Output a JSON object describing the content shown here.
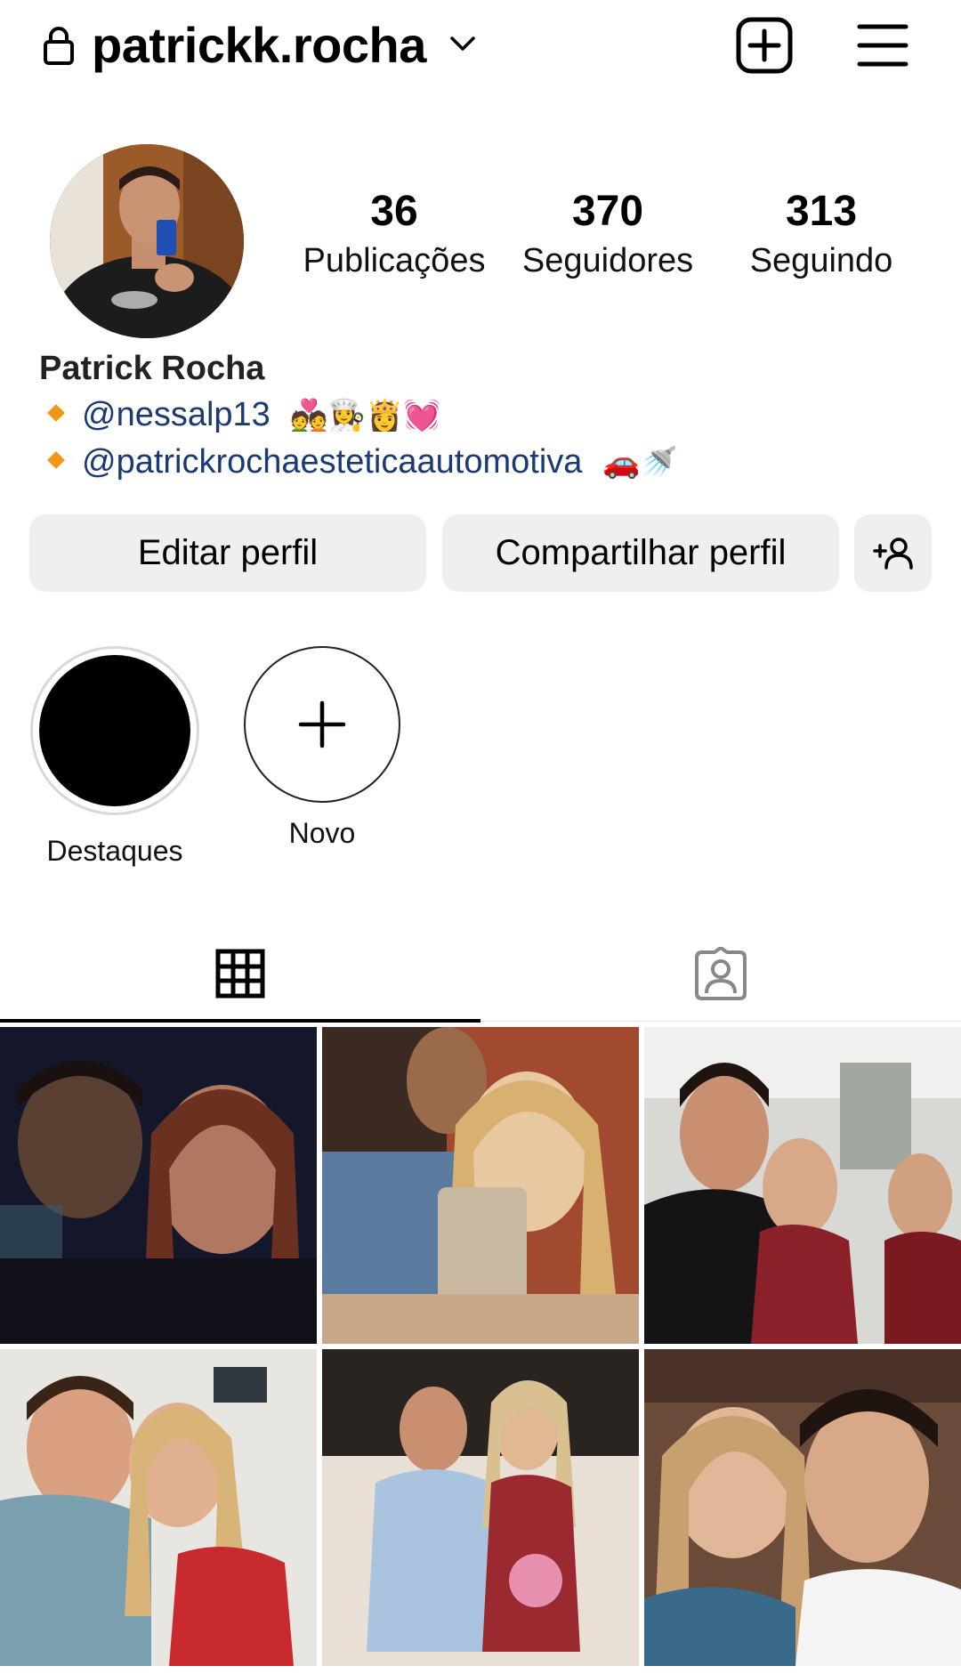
{
  "header": {
    "username": "patrickk.rocha",
    "icons": [
      "lock-icon",
      "chevron-down-icon",
      "new-post-icon",
      "menu-icon"
    ]
  },
  "profile": {
    "full_name": "Patrick Rocha",
    "stats": {
      "posts": {
        "value": "36",
        "label": "Publicações"
      },
      "followers": {
        "value": "370",
        "label": "Seguidores"
      },
      "following": {
        "value": "313",
        "label": "Seguindo"
      }
    },
    "bio": [
      {
        "text": "@nessalp13",
        "emoji": "💑👩‍🍳👸💓"
      },
      {
        "text": "@patrickrochaesteticaautomotiva",
        "emoji": "🚗🚿"
      }
    ]
  },
  "actions": {
    "edit_label": "Editar perfil",
    "share_label": "Compartilhar perfil",
    "suggest_icon": "add-person-icon"
  },
  "highlights": [
    {
      "label": "Destaques"
    },
    {
      "label": "Novo"
    }
  ],
  "tabs": [
    {
      "name": "grid",
      "icon": "grid-icon",
      "active": true
    },
    {
      "name": "tagged",
      "icon": "tagged-user-icon",
      "active": false
    }
  ],
  "colors": {
    "link": "#1b3a73",
    "button_bg": "#efefef",
    "bio_bullet": "#f29718"
  }
}
